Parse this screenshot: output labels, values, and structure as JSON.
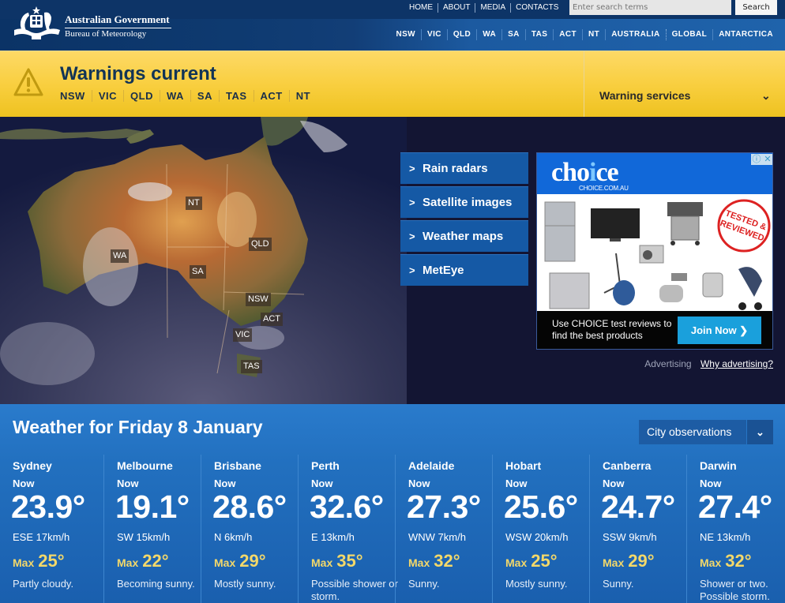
{
  "header": {
    "org_name": "Australian Government",
    "agency_name": "Bureau of Meteorology",
    "top_nav": [
      "HOME",
      "ABOUT",
      "MEDIA",
      "CONTACTS"
    ],
    "search": {
      "placeholder": "Enter search terms",
      "button_label": "Search"
    },
    "state_nav": [
      "NSW",
      "VIC",
      "QLD",
      "WA",
      "SA",
      "TAS",
      "ACT",
      "NT",
      "AUSTRALIA",
      "GLOBAL",
      "ANTARCTICA"
    ]
  },
  "warnings": {
    "title": "Warnings current",
    "states": [
      "NSW",
      "VIC",
      "QLD",
      "WA",
      "SA",
      "TAS",
      "ACT",
      "NT"
    ],
    "services_label": "Warning services",
    "icon": "warning-triangle-icon"
  },
  "map": {
    "labels": [
      "NT",
      "WA",
      "QLD",
      "SA",
      "NSW",
      "ACT",
      "VIC",
      "TAS"
    ]
  },
  "quick_links": [
    {
      "label": "Rain radars"
    },
    {
      "label": "Satellite images"
    },
    {
      "label": "Weather maps"
    },
    {
      "label": "MetEye"
    }
  ],
  "ad": {
    "brand": "choice",
    "brand_url_text": "CHOICE.COM.AU",
    "stamp_text": "TESTED & REVIEWED",
    "cta_text": "Use CHOICE test reviews to find the best products",
    "button_label": "Join Now",
    "advertising_label": "Advertising",
    "why_link": "Why advertising?"
  },
  "weather": {
    "title": "Weather for Friday 8 January",
    "select_label": "City observations",
    "now_label": "Now",
    "max_label": "Max",
    "cities": [
      {
        "name": "Sydney",
        "temp": "23.9°",
        "wind": "ESE 17km/h",
        "max": "25°",
        "desc": "Partly cloudy."
      },
      {
        "name": "Melbourne",
        "temp": "19.1°",
        "wind": "SW 15km/h",
        "max": "22°",
        "desc": "Becoming sunny."
      },
      {
        "name": "Brisbane",
        "temp": "28.6°",
        "wind": "N 6km/h",
        "max": "29°",
        "desc": "Mostly sunny."
      },
      {
        "name": "Perth",
        "temp": "32.6°",
        "wind": "E 13km/h",
        "max": "35°",
        "desc": "Possible shower or storm."
      },
      {
        "name": "Adelaide",
        "temp": "27.3°",
        "wind": "WNW 7km/h",
        "max": "32°",
        "desc": "Sunny."
      },
      {
        "name": "Hobart",
        "temp": "25.6°",
        "wind": "WSW 20km/h",
        "max": "25°",
        "desc": "Mostly sunny."
      },
      {
        "name": "Canberra",
        "temp": "24.7°",
        "wind": "SSW 9km/h",
        "max": "29°",
        "desc": "Sunny."
      },
      {
        "name": "Darwin",
        "temp": "27.4°",
        "wind": "NE 13km/h",
        "max": "32°",
        "desc": "Shower or two. Possible storm."
      }
    ]
  },
  "colors": {
    "header_navy": "#0d3467",
    "warning_yellow": "#f9cf40",
    "link_blue": "#1559a5",
    "weather_blue": "#2270bf",
    "max_gold": "#f3d86a"
  }
}
